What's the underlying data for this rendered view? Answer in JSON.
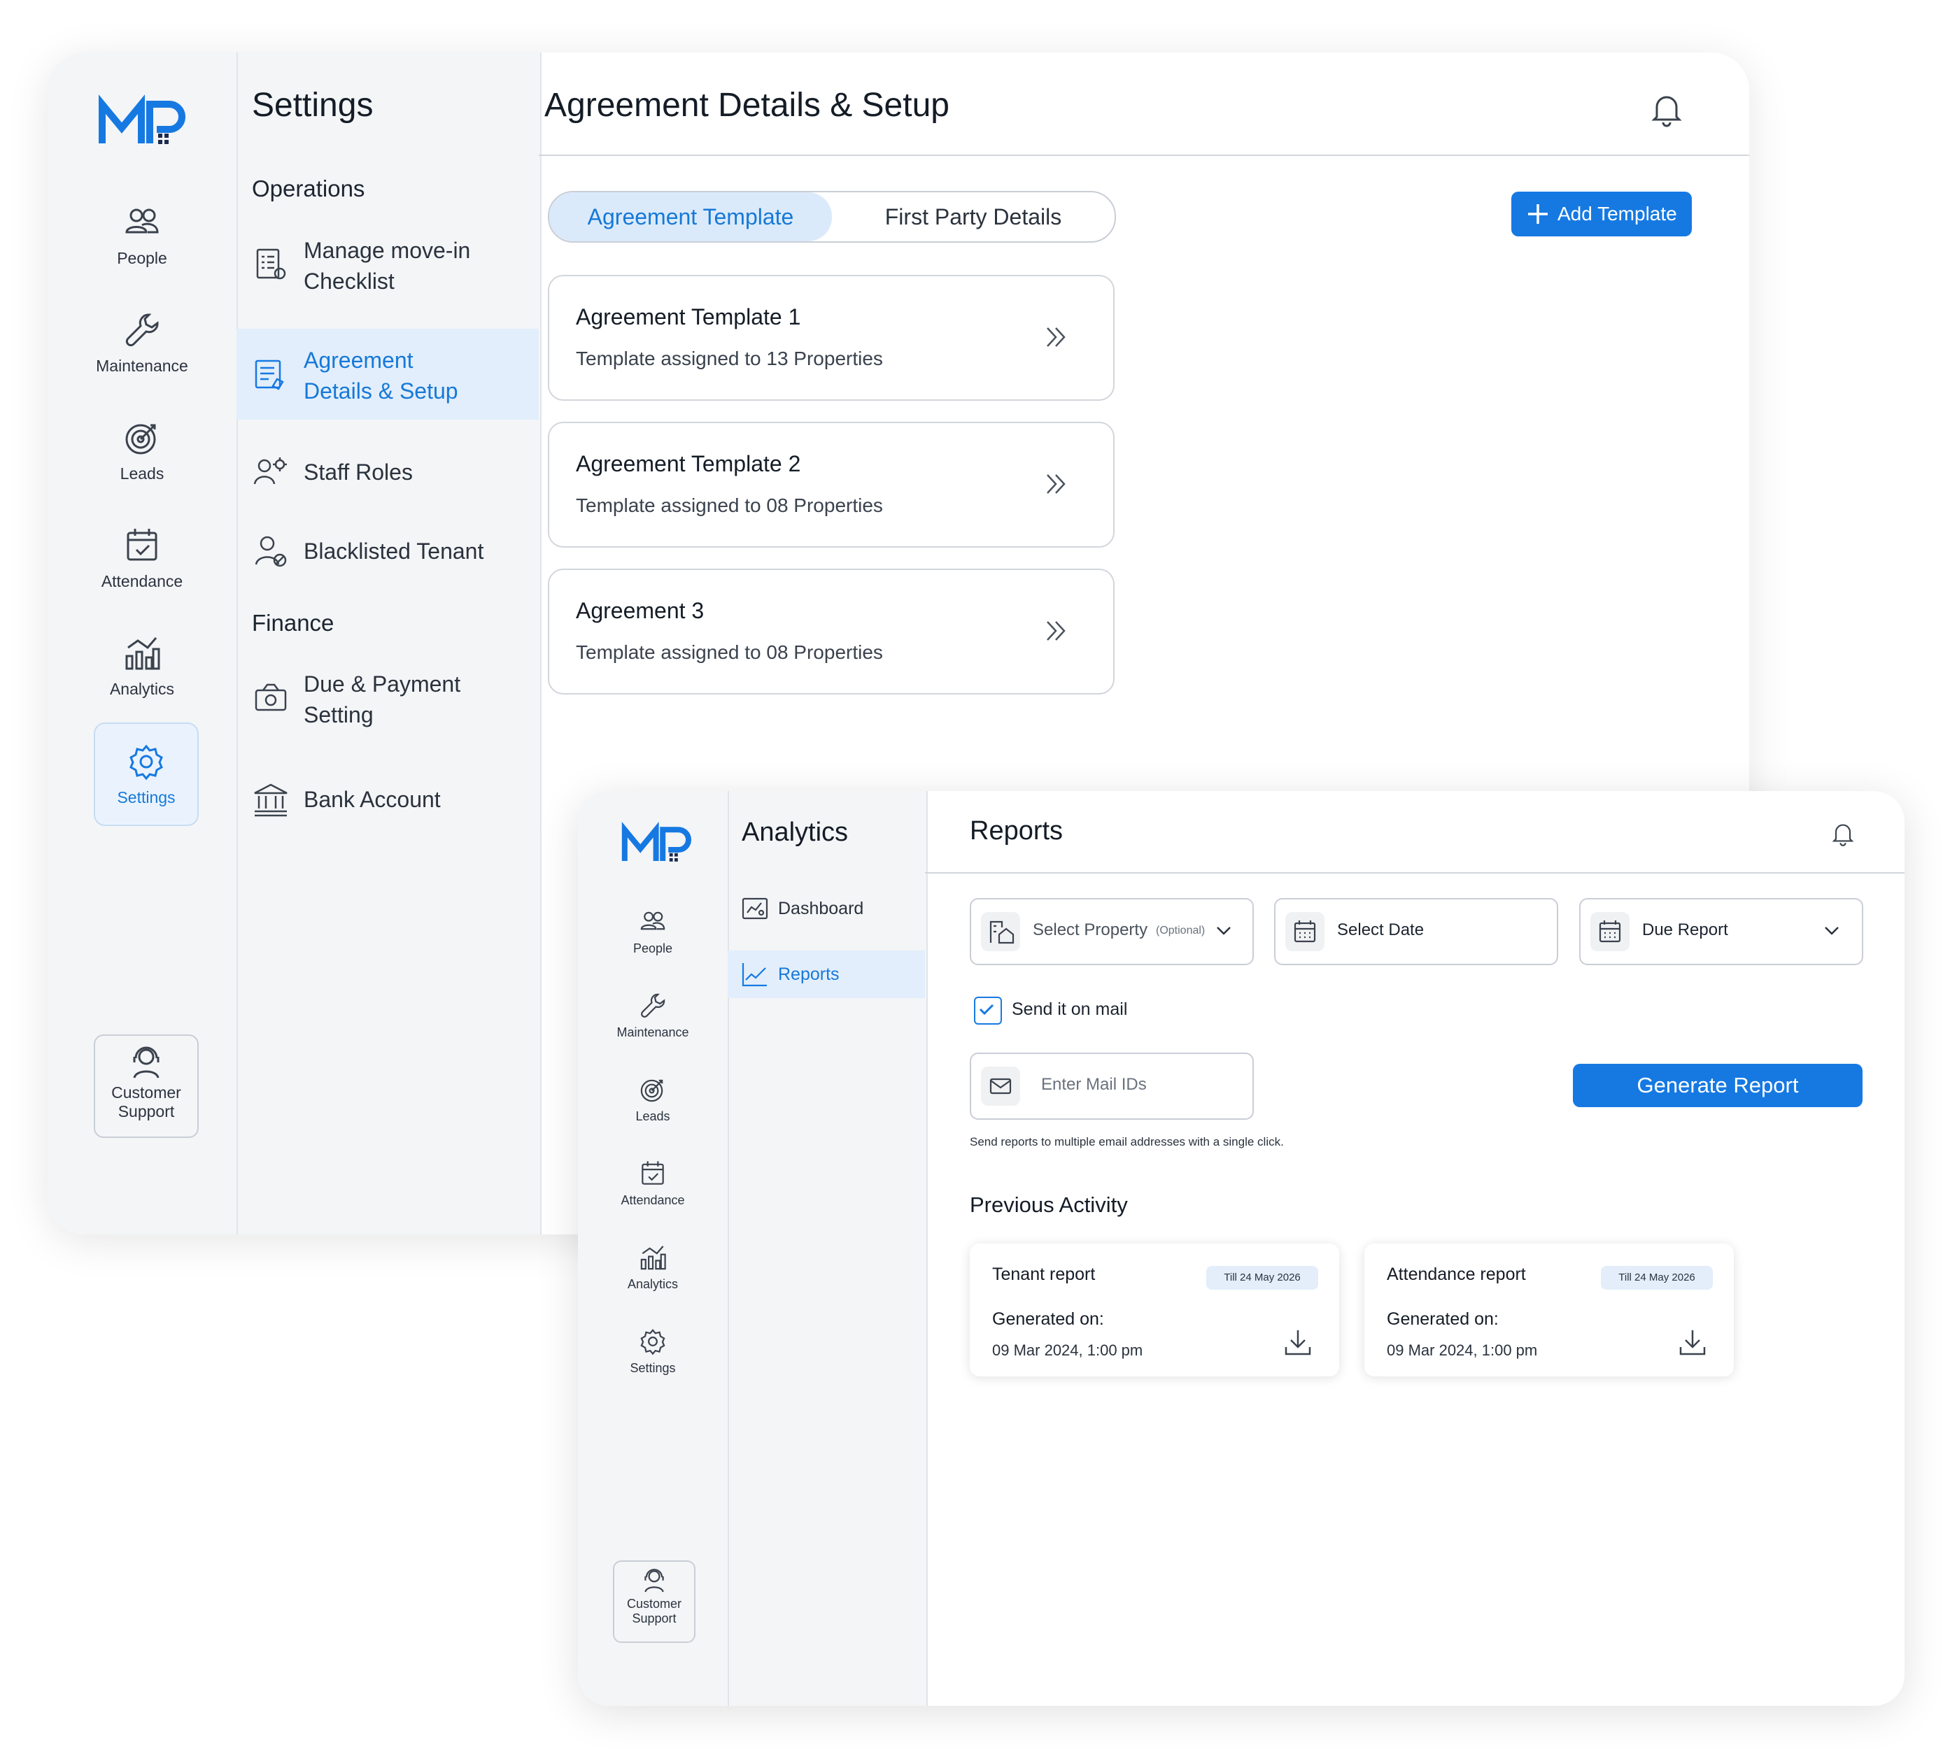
{
  "brand": {
    "logo_text": "MP",
    "accent": "#1679e2"
  },
  "window_a": {
    "rail": {
      "items": [
        {
          "label": "People",
          "icon": "people-icon"
        },
        {
          "label": "Maintenance",
          "icon": "wrench-icon"
        },
        {
          "label": "Leads",
          "icon": "target-icon"
        },
        {
          "label": "Attendance",
          "icon": "calendar-check-icon"
        },
        {
          "label": "Analytics",
          "icon": "analytics-icon"
        },
        {
          "label": "Settings",
          "icon": "gear-icon",
          "selected": true
        }
      ],
      "support": {
        "line1": "Customer",
        "line2": "Support"
      }
    },
    "submenu": {
      "title": "Settings",
      "sections": [
        {
          "heading": "Operations"
        },
        {
          "heading": "Finance"
        }
      ],
      "items": [
        {
          "line1": "Manage move-in",
          "line2": "Checklist"
        },
        {
          "line1": "Agreement",
          "line2": "Details & Setup",
          "selected": true
        },
        {
          "line1": "Staff Roles"
        },
        {
          "line1": "Blacklisted Tenant"
        },
        {
          "line1": "Due & Payment",
          "line2": "Setting"
        },
        {
          "line1": "Bank Account"
        }
      ]
    },
    "header": {
      "title": "Agreement Details & Setup"
    },
    "tabs": [
      {
        "label": "Agreement Template",
        "active": true
      },
      {
        "label": "First Party Details"
      }
    ],
    "add_button": "Add Template",
    "cards": [
      {
        "title": "Agreement Template 1",
        "subtitle": "Template assigned to 13 Properties"
      },
      {
        "title": "Agreement Template 2",
        "subtitle": "Template assigned to 08 Properties"
      },
      {
        "title": "Agreement 3",
        "subtitle": "Template assigned to 08 Properties"
      }
    ]
  },
  "window_b": {
    "rail": {
      "items": [
        {
          "label": "People"
        },
        {
          "label": "Maintenance"
        },
        {
          "label": "Leads"
        },
        {
          "label": "Attendance"
        },
        {
          "label": "Analytics"
        },
        {
          "label": "Settings"
        }
      ],
      "support": {
        "line1": "Customer",
        "line2": "Support"
      }
    },
    "submenu": {
      "title": "Analytics",
      "items": [
        {
          "label": "Dashboard"
        },
        {
          "label": "Reports",
          "selected": true
        }
      ]
    },
    "header": {
      "title": "Reports"
    },
    "filters": {
      "property": {
        "label": "Select Property",
        "optional": "(Optional)"
      },
      "date": {
        "label": "Select Date"
      },
      "report": {
        "label": "Due Report"
      }
    },
    "send_mail": {
      "label": "Send it on mail",
      "checked": true
    },
    "mail_input": {
      "placeholder": "Enter Mail IDs"
    },
    "generate_button": "Generate Report",
    "hint": "Send reports to multiple email addresses with a single click.",
    "previous_activity": {
      "title": "Previous Activity",
      "items": [
        {
          "name": "Tenant report",
          "badge": "Till 24 May 2026",
          "generated_label": "Generated on:",
          "generated_at": "09 Mar 2024, 1:00 pm"
        },
        {
          "name": "Attendance report",
          "badge": "Till 24 May 2026",
          "generated_label": "Generated on:",
          "generated_at": "09 Mar 2024, 1:00 pm"
        }
      ]
    }
  }
}
